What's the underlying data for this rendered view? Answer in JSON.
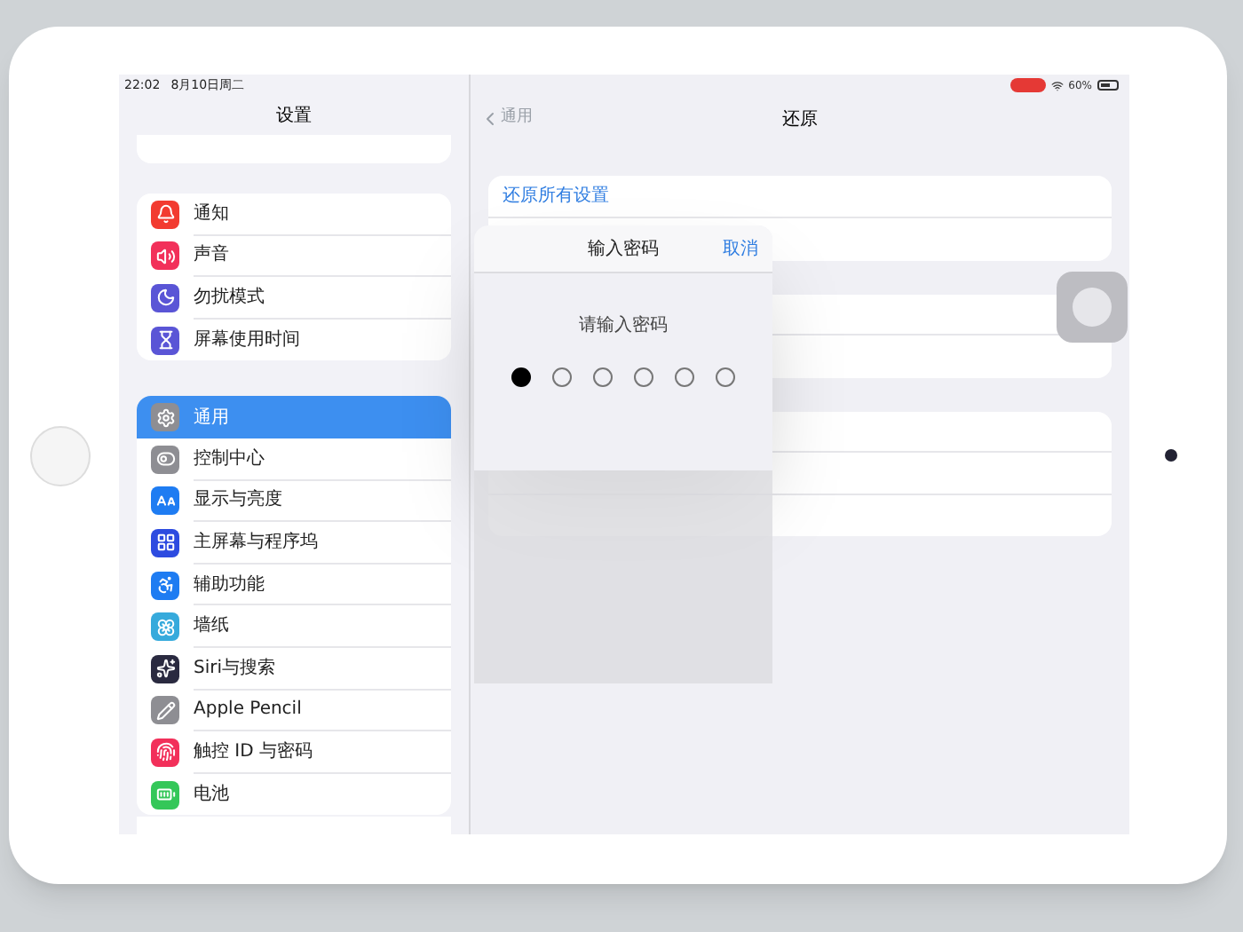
{
  "status_bar": {
    "time": "22:02",
    "date": "8月10日周二",
    "battery": "60%"
  },
  "sidebar": {
    "title": "设置",
    "groups": [
      {
        "items": [
          {
            "label": "通知",
            "color": "#f23b30",
            "selected": false
          },
          {
            "label": "声音",
            "color": "#f2305a",
            "selected": false
          },
          {
            "label": "勿扰模式",
            "color": "#5a55d6",
            "selected": false
          },
          {
            "label": "屏幕使用时间",
            "color": "#5a55d6",
            "selected": false
          }
        ]
      },
      {
        "items": [
          {
            "label": "通用",
            "color": "#8e8e93",
            "selected": true
          },
          {
            "label": "控制中心",
            "color": "#8e8e93",
            "selected": false
          },
          {
            "label": "显示与亮度",
            "color": "#1e7cf2",
            "selected": false
          },
          {
            "label": "主屏幕与程序坞",
            "color": "#2d4be0",
            "selected": false
          },
          {
            "label": "辅助功能",
            "color": "#1e7cf2",
            "selected": false
          },
          {
            "label": "墙纸",
            "color": "#36aadc",
            "selected": false
          },
          {
            "label": "Siri与搜索",
            "color": "#2a2a40",
            "selected": false
          },
          {
            "label": "Apple Pencil",
            "color": "#8e8e93",
            "selected": false
          },
          {
            "label": "触控 ID 与密码",
            "color": "#f2305a",
            "selected": false
          },
          {
            "label": "电池",
            "color": "#34c759",
            "selected": false
          }
        ]
      }
    ]
  },
  "detail": {
    "back": "通用",
    "title": "还原",
    "first_row": "还原所有设置"
  },
  "dialog": {
    "title": "输入密码",
    "cancel": "取消",
    "prompt": "请输入密码",
    "digits": [
      {
        "filled": true
      },
      {
        "filled": false
      },
      {
        "filled": false
      },
      {
        "filled": false
      },
      {
        "filled": false
      },
      {
        "filled": false
      }
    ]
  }
}
